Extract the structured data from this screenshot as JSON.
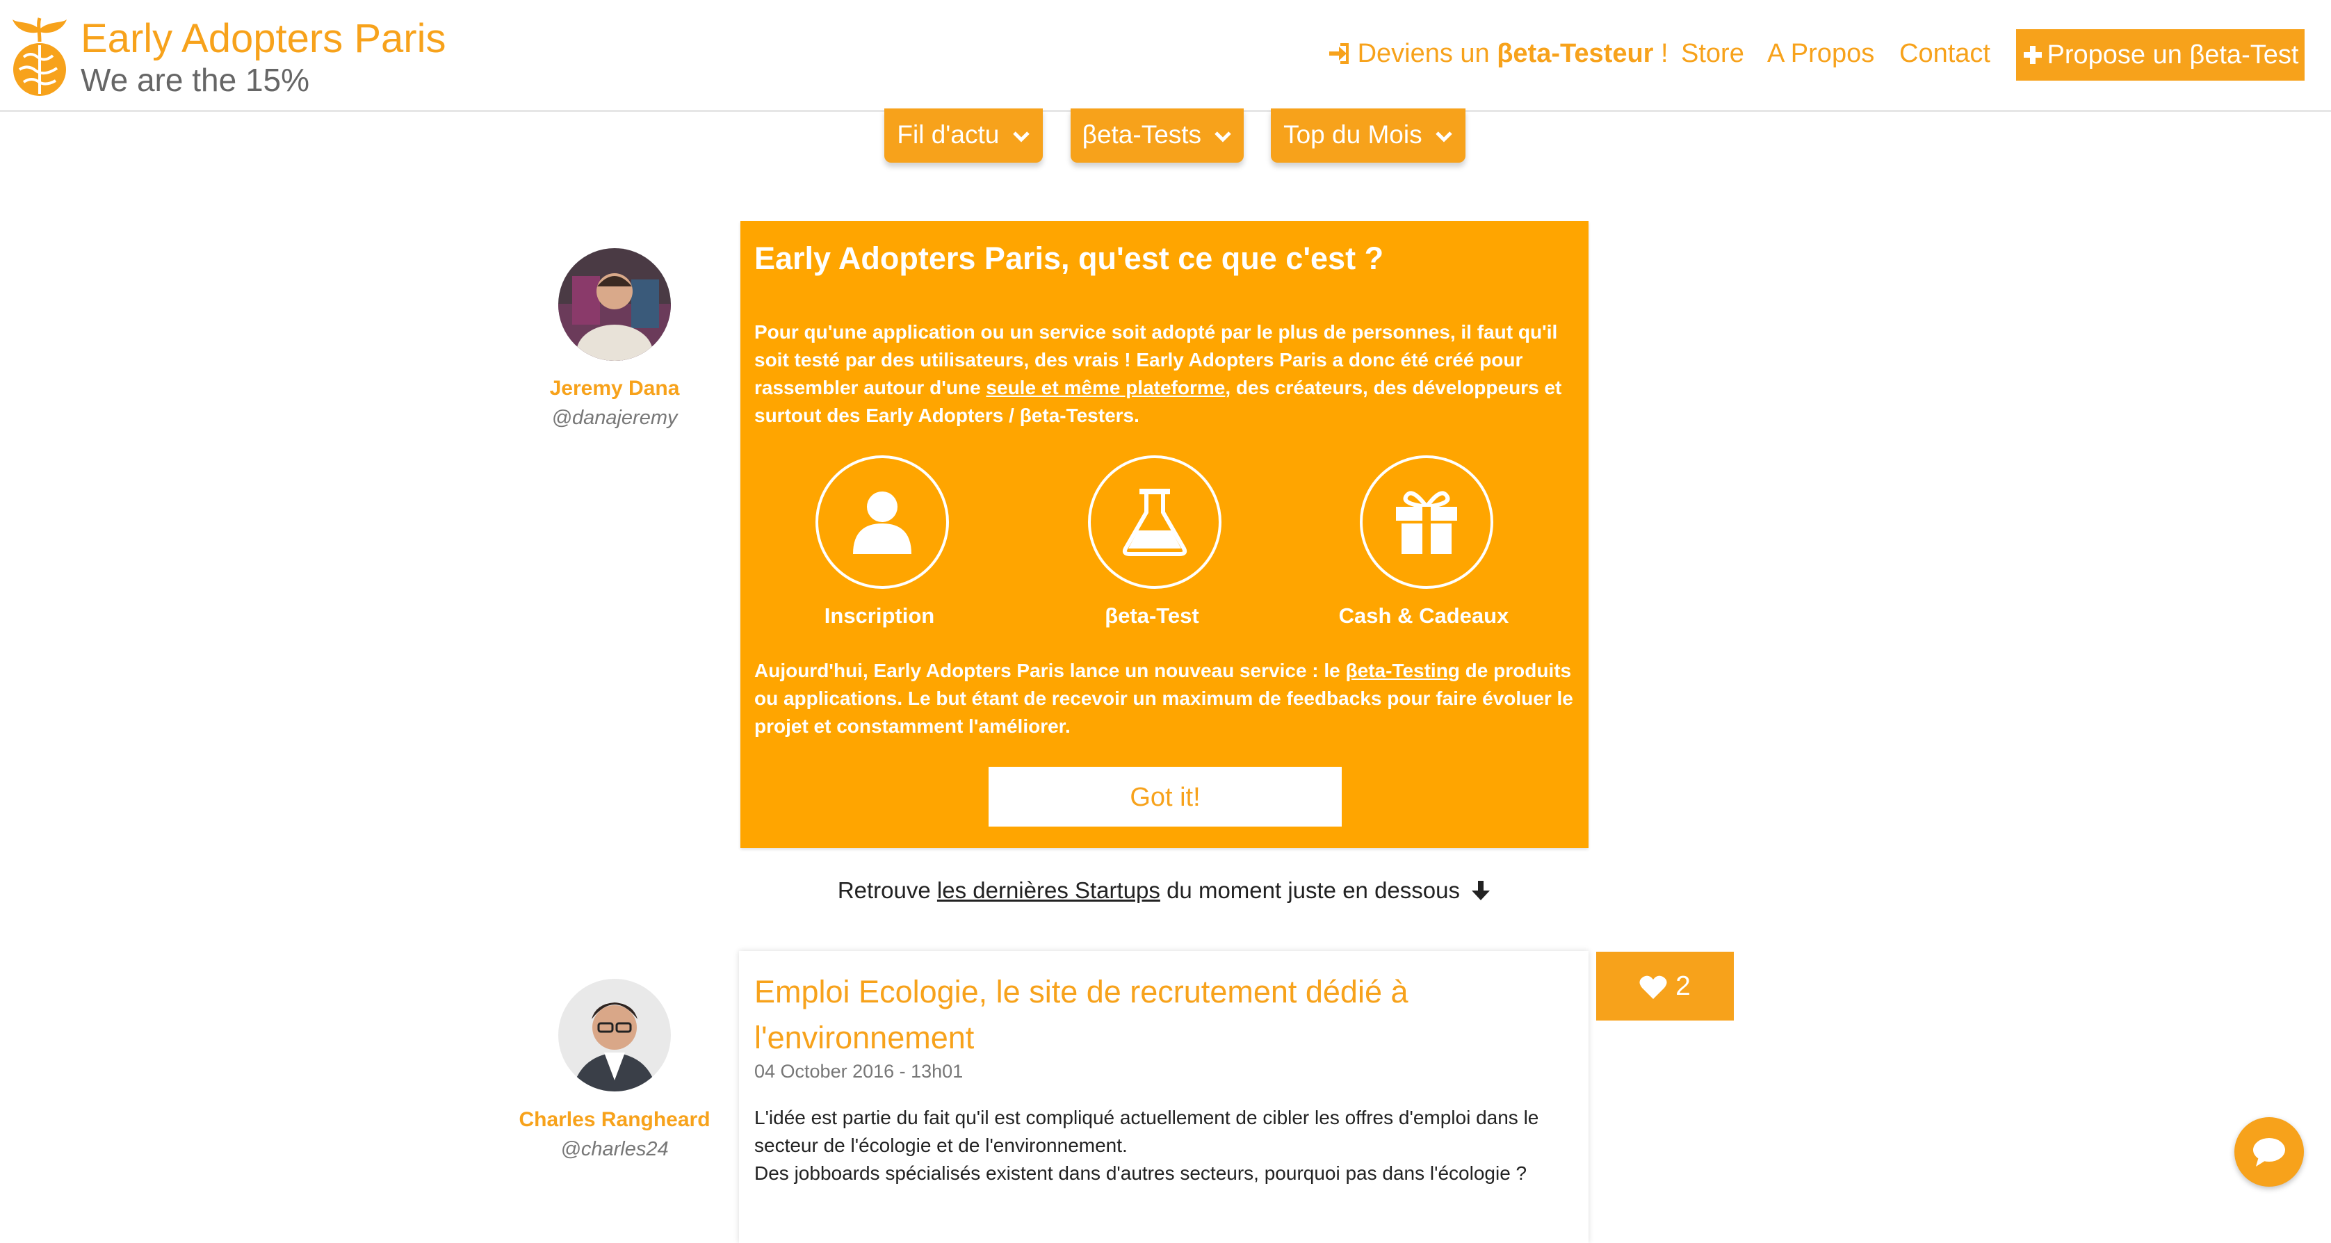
{
  "header": {
    "brand_title": "Early Adopters Paris",
    "brand_subtitle": "We are the 15%",
    "nav": {
      "beta_prefix": "Deviens un ",
      "beta_bold": "βeta-Testeur",
      "beta_suffix": " !",
      "store": "Store",
      "apropos": "A Propos",
      "contact": "Contact",
      "propose": "Propose un βeta-Test"
    }
  },
  "tabs": [
    {
      "label": "Fil d'actu"
    },
    {
      "label": "βeta-Tests"
    },
    {
      "label": "Top du Mois"
    }
  ],
  "intro": {
    "author_name": "Jeremy Dana",
    "author_handle": "@danajeremy",
    "title": "Early Adopters Paris, qu'est ce que c'est ?",
    "p1_a": "Pour qu'une application ou un service soit adopté par le plus de personnes, il faut qu'il soit testé par des utilisateurs, des vrais ! Early Adopters Paris a donc été créé pour rassembler autour d'une ",
    "p1_link": "seule et même plateforme",
    "p1_b": ", des créateurs, des développeurs et surtout des Early Adopters / βeta-Testers.",
    "steps": [
      {
        "label": "Inscription",
        "icon": "user-icon"
      },
      {
        "label": "βeta-Test",
        "icon": "flask-icon"
      },
      {
        "label": "Cash & Cadeaux",
        "icon": "gift-icon"
      }
    ],
    "p2_a": "Aujourd'hui, Early Adopters Paris lance un nouveau service : le ",
    "p2_link": "βeta-Testing",
    "p2_b": " de produits ou applications. Le but étant de recevoir un maximum de feedbacks pour faire évoluer le projet et constamment l'améliorer.",
    "got_it": "Got it!"
  },
  "retrouve": {
    "prefix": "Retrouve ",
    "link": "les dernières Startups",
    "suffix": " du moment juste en dessous"
  },
  "post": {
    "author_name": "Charles Rangheard",
    "author_handle": "@charles24",
    "title": "Emploi Ecologie, le site de recrutement dédié à l'environnement",
    "date": "04 October 2016 - 13h01",
    "body_1": "L'idée est partie du fait qu'il est compliqué actuellement de cibler les offres d'emploi dans le secteur de l'écologie et de l'environnement.",
    "body_2": "Des jobboards spécialisés existent dans d'autres secteurs, pourquoi pas dans l'écologie ?",
    "likes": "2"
  },
  "colors": {
    "accent": "#F7A21B",
    "card": "#FFA500"
  }
}
